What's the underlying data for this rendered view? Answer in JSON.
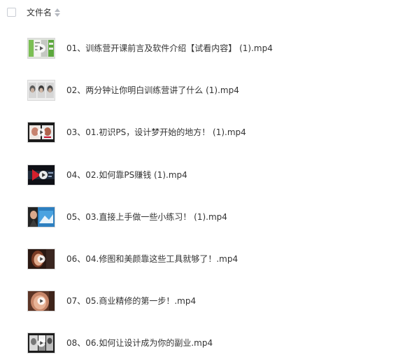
{
  "header": {
    "column_title": "文件名",
    "sort_icon": "sort-icon"
  },
  "files": [
    {
      "name": "01、训练营开课前言及软件介绍【试看内容】 (1).mp4",
      "thumb": "software-ui"
    },
    {
      "name": "02、两分钟让你明白训练营讲了什么 (1).mp4",
      "thumb": "portraits"
    },
    {
      "name": "03、01.初识PS，设计梦开始的地方！ (1).mp4",
      "thumb": "photo-edit"
    },
    {
      "name": "04、02.如何靠PS赚钱 (1).mp4",
      "thumb": "dark-banner"
    },
    {
      "name": "05、03.直接上手做一些小练习！ (1).mp4",
      "thumb": "blue-photo"
    },
    {
      "name": "06、04.修图和美颜靠这些工具就够了！.mp4",
      "thumb": "face-retouch"
    },
    {
      "name": "07、05.商业精修的第一步！.mp4",
      "thumb": "face-closeup"
    },
    {
      "name": "08、06.如何让设计成为你的副业.mp4",
      "thumb": "bw-collage"
    }
  ]
}
